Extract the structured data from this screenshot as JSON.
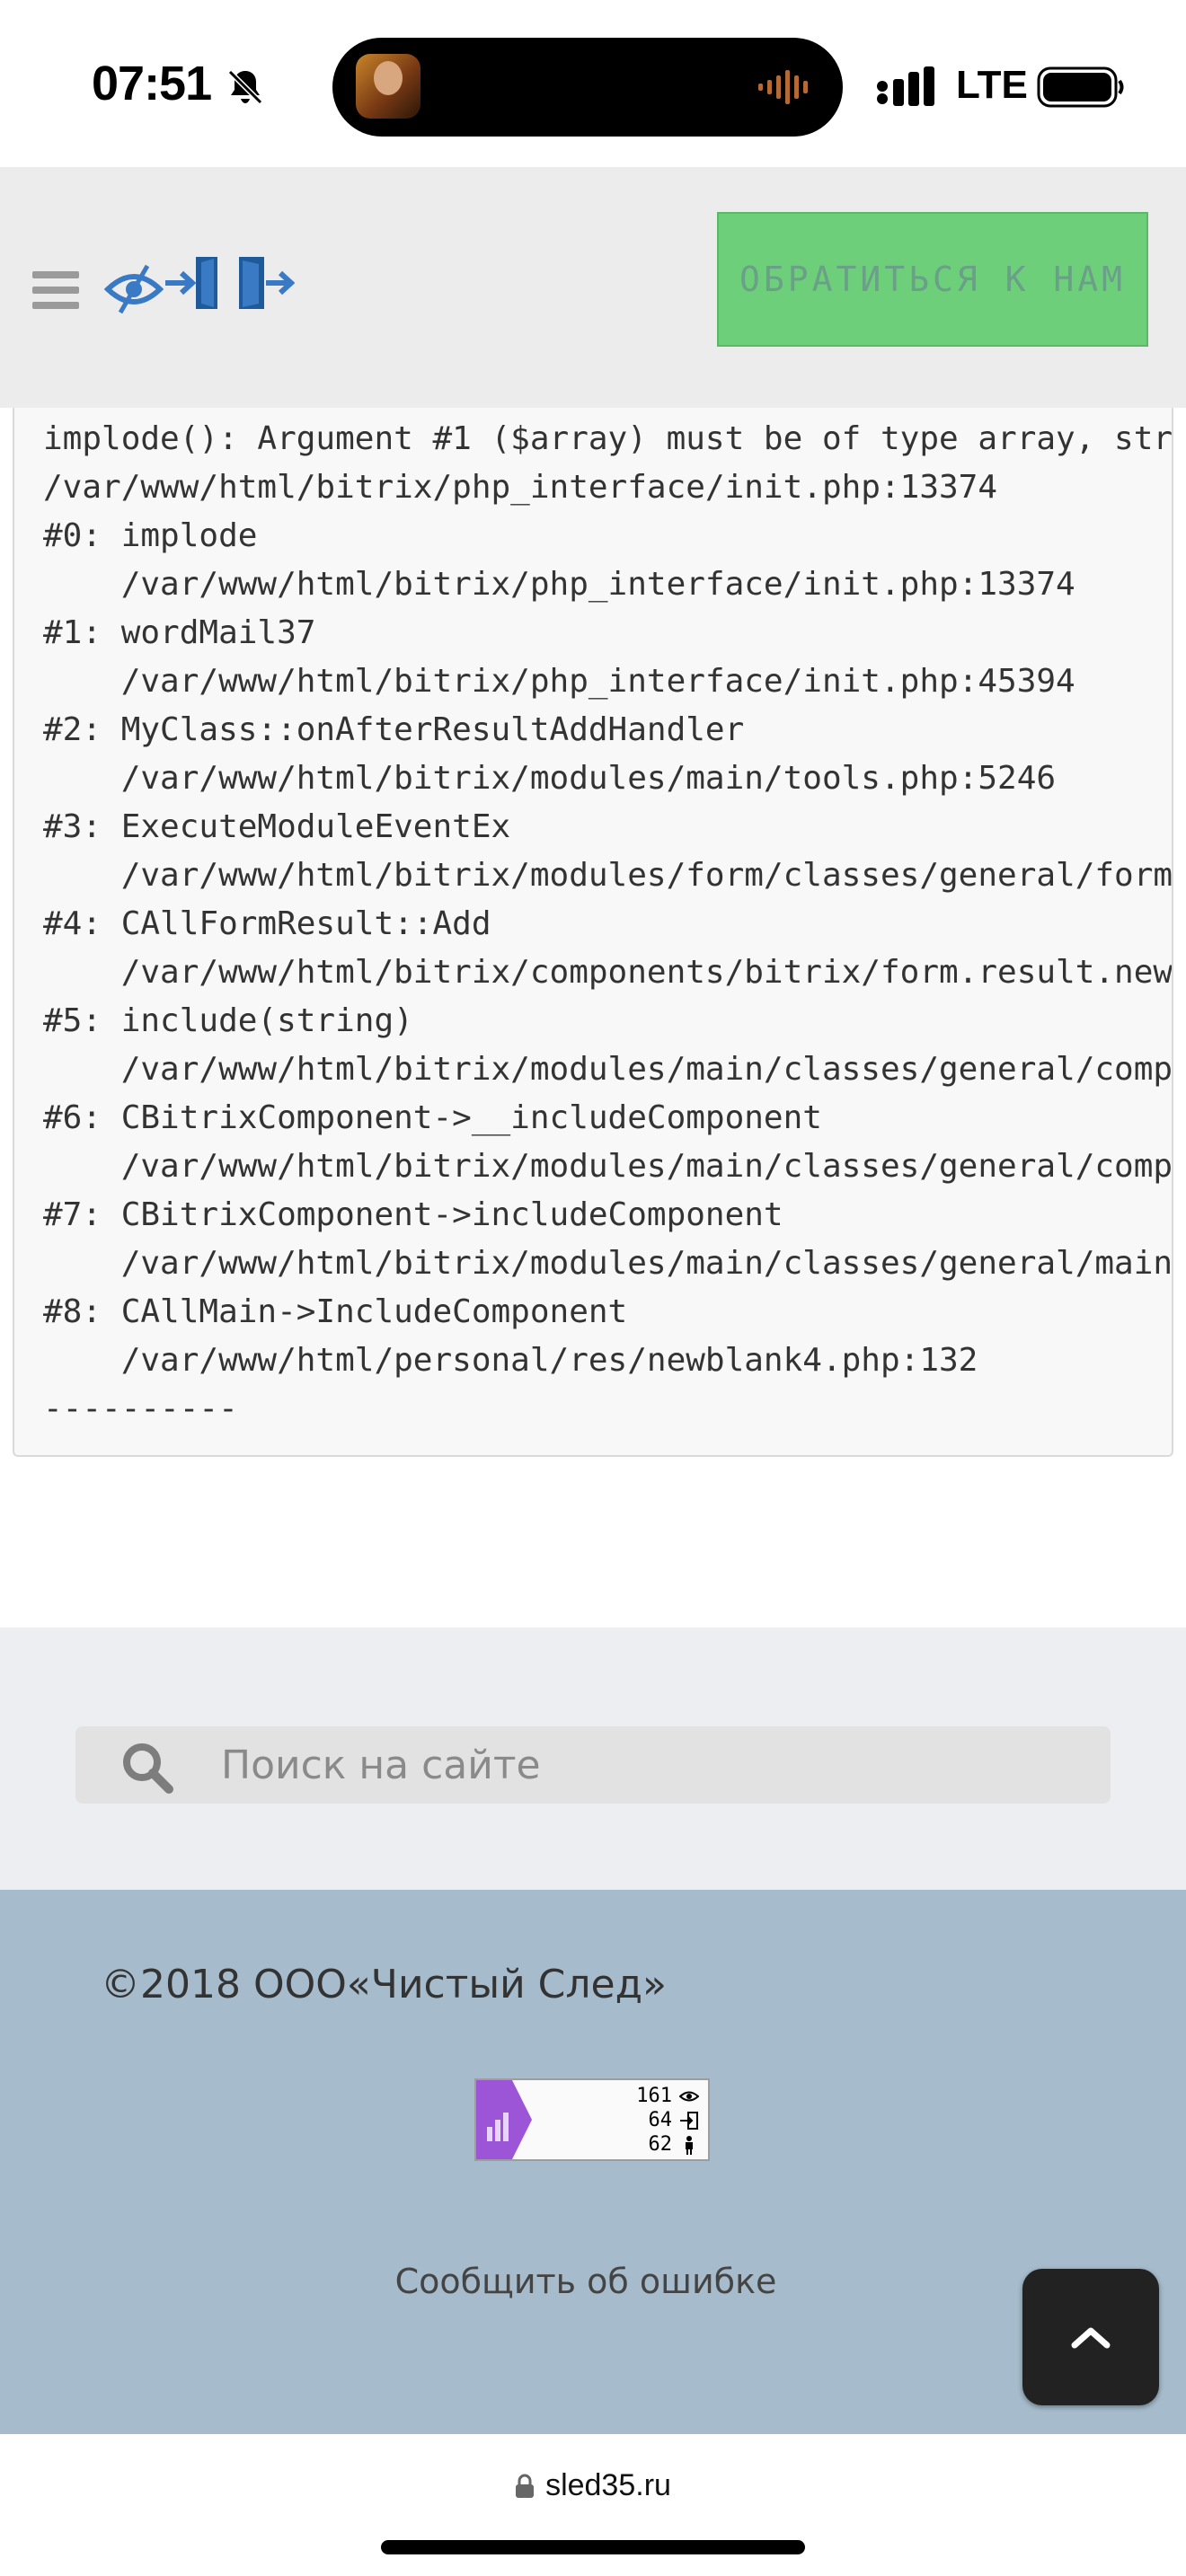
{
  "status_bar": {
    "time": "07:51",
    "network": "LTE"
  },
  "header": {
    "contact_button_label": "ОБРАТИТЬСЯ К НАМ",
    "colors": {
      "button_bg": "#6dcf7a",
      "icon_blue": "#3a7ac4"
    }
  },
  "error_trace": {
    "lines": [
      "implode(): Argument #1 ($array) must be of type array, str",
      "/var/www/html/bitrix/php_interface/init.php:13374",
      "#0: implode",
      "    /var/www/html/bitrix/php_interface/init.php:13374",
      "#1: wordMail37",
      "    /var/www/html/bitrix/php_interface/init.php:45394",
      "#2: MyClass::onAfterResultAddHandler",
      "    /var/www/html/bitrix/modules/main/tools.php:5246",
      "#3: ExecuteModuleEventEx",
      "    /var/www/html/bitrix/modules/form/classes/general/form_",
      "#4: CAllFormResult::Add",
      "    /var/www/html/bitrix/components/bitrix/form.result.new",
      "#5: include(string)",
      "    /var/www/html/bitrix/modules/main/classes/general/compo",
      "#6: CBitrixComponent->__includeComponent",
      "    /var/www/html/bitrix/modules/main/classes/general/compo",
      "#7: CBitrixComponent->includeComponent",
      "    /var/www/html/bitrix/modules/main/classes/general/main_",
      "#8: CAllMain->IncludeComponent",
      "    /var/www/html/personal/res/newblank4.php:132",
      "----------"
    ]
  },
  "search": {
    "placeholder": "Поиск на сайте",
    "value": ""
  },
  "footer": {
    "copyright": "©2018 ООО«Чистый След»",
    "counter": {
      "views": "161",
      "sessions": "64",
      "visitors": "62"
    },
    "report_error": "Сообщить об ошибке"
  },
  "browser": {
    "url": "sled35.ru"
  }
}
